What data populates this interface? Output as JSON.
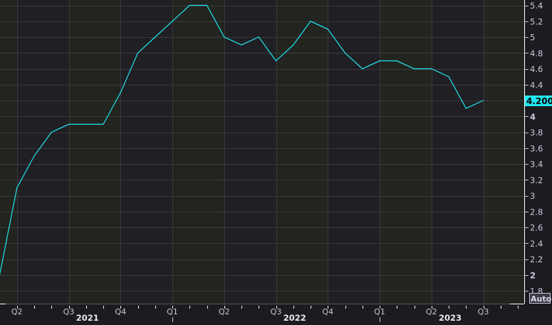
{
  "chart_data": {
    "type": "line",
    "title": "",
    "xlabel": "",
    "ylabel": "",
    "x": [
      "2021-03",
      "2021-04",
      "2021-05",
      "2021-06",
      "2021-07",
      "2021-08",
      "2021-09",
      "2021-10",
      "2021-11",
      "2021-12",
      "2022-01",
      "2022-02",
      "2022-03",
      "2022-04",
      "2022-05",
      "2022-06",
      "2022-07",
      "2022-08",
      "2022-09",
      "2022-10",
      "2022-11",
      "2022-12",
      "2023-01",
      "2023-02",
      "2023-03",
      "2023-04",
      "2023-05",
      "2023-06",
      "2023-07"
    ],
    "series": [
      {
        "values": [
          2.0,
          3.1,
          3.5,
          3.8,
          3.9,
          3.9,
          3.9,
          4.3,
          4.8,
          5.0,
          5.2,
          5.4,
          5.4,
          5.0,
          4.9,
          5.0,
          4.7,
          4.9,
          5.2,
          5.1,
          4.8,
          4.6,
          4.7,
          4.7,
          4.6,
          4.6,
          4.5,
          4.1,
          4.2
        ],
        "color": "#1ee6f0"
      }
    ],
    "ylim": [
      1.8,
      5.4
    ],
    "xlim": [
      "2021-03",
      "2023-09"
    ],
    "y_ticks": [
      "5.4",
      "5.2",
      "5",
      "4.8",
      "4.6",
      "4.4",
      "4.2",
      "4",
      "3.8",
      "3.6",
      "3.4",
      "3.2",
      "3",
      "2.8",
      "2.6",
      "2.4",
      "2.2",
      "2",
      "1.8"
    ],
    "y_tick_values": [
      5.4,
      5.2,
      5.0,
      4.8,
      4.6,
      4.4,
      4.2,
      4.0,
      3.8,
      3.6,
      3.4,
      3.2,
      3.0,
      2.8,
      2.6,
      2.4,
      2.2,
      2.0,
      1.8
    ],
    "x_quarter_ticks": [
      {
        "label": "Q2",
        "month": "2021-04"
      },
      {
        "label": "Q3",
        "month": "2021-07"
      },
      {
        "label": "Q4",
        "month": "2021-10"
      },
      {
        "label": "Q1",
        "month": "2022-01"
      },
      {
        "label": "Q2",
        "month": "2022-04"
      },
      {
        "label": "Q3",
        "month": "2022-07"
      },
      {
        "label": "Q4",
        "month": "2022-10"
      },
      {
        "label": "Q1",
        "month": "2023-01"
      },
      {
        "label": "Q2",
        "month": "2023-04"
      },
      {
        "label": "Q3",
        "month": "2023-07"
      }
    ],
    "x_year_labels": [
      {
        "label": "2021",
        "month": "2021-08"
      },
      {
        "label": "2022",
        "month": "2022-08"
      },
      {
        "label": "2023",
        "month": "2023-05"
      }
    ],
    "last_value_label": "4.200",
    "grid": true,
    "legend": "none"
  },
  "axis": {
    "auto_button": "Auto"
  },
  "colors": {
    "background": "#1c1b1f",
    "band_a": "#222420",
    "band_b": "#201f23",
    "grid": "#3a3a3c",
    "axis_text": "#c8c8dc",
    "line": "#1ee6f0"
  }
}
